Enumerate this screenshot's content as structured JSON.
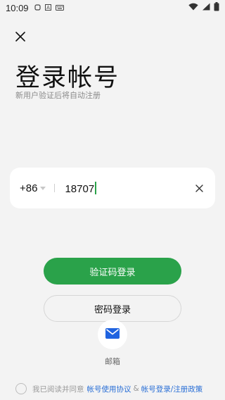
{
  "status_bar": {
    "time": "10:09",
    "left_icons": [
      "rounded-square-icon",
      "a-letter-icon",
      "keyboard-icon"
    ],
    "right_icons": [
      "wifi-icon",
      "signal-icon",
      "battery-icon"
    ]
  },
  "header": {
    "close_icon": "close-icon",
    "title": "登录帐号",
    "subtitle": "新用户验证后将自动注册"
  },
  "phone": {
    "country_code": "+86",
    "value": "18707",
    "clear_icon": "close-icon"
  },
  "buttons": {
    "primary_label": "验证码登录",
    "secondary_label": "密码登录"
  },
  "email": {
    "icon": "mail-icon",
    "label": "邮箱"
  },
  "agreement": {
    "prefix": "我已阅读并同意",
    "link_1": "帐号使用协议",
    "amp": "&",
    "link_2": "帐号登录/注册政策"
  },
  "colors": {
    "accent": "#2aa24a",
    "link": "#2a6fd6",
    "background": "#f3f3f3",
    "mail_icon": "#1f63e0"
  }
}
